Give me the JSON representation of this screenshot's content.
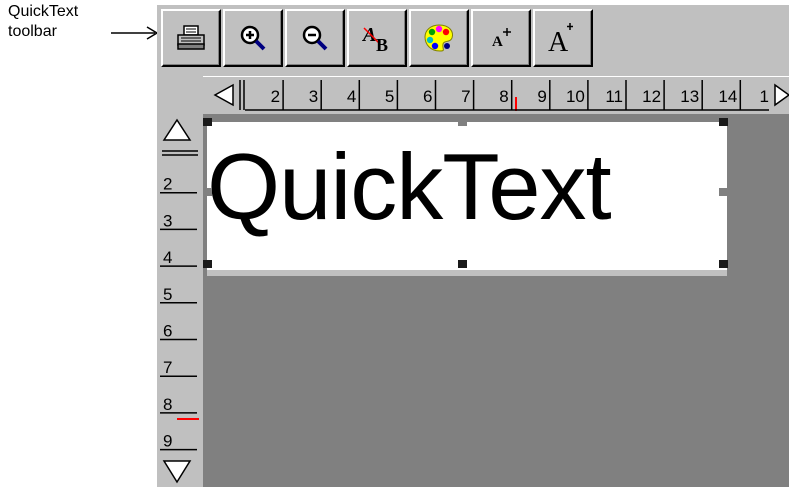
{
  "callout": {
    "line1": "QuickText",
    "line2": "toolbar"
  },
  "toolbar": {
    "buttons": [
      {
        "name": "print",
        "icon": "printer-icon"
      },
      {
        "name": "zoom-in",
        "icon": "zoom-in-icon"
      },
      {
        "name": "zoom-out",
        "icon": "zoom-out-icon"
      },
      {
        "name": "font",
        "icon": "font-icon"
      },
      {
        "name": "color",
        "icon": "palette-icon"
      },
      {
        "name": "size-small",
        "icon": "font-size-small-icon"
      },
      {
        "name": "size-large",
        "icon": "font-size-large-icon"
      }
    ]
  },
  "hruler": {
    "labels": [
      "2",
      "3",
      "4",
      "5",
      "6",
      "7",
      "8",
      "9",
      "10",
      "11",
      "12",
      "13",
      "14",
      "1"
    ]
  },
  "vruler": {
    "labels": [
      "2",
      "3",
      "4",
      "5",
      "6",
      "7",
      "8",
      "9"
    ]
  },
  "canvas": {
    "text": "QuickText"
  },
  "colors": {
    "face": "#c0c0c0",
    "workspace": "#808080",
    "marker": "#ff0000"
  }
}
